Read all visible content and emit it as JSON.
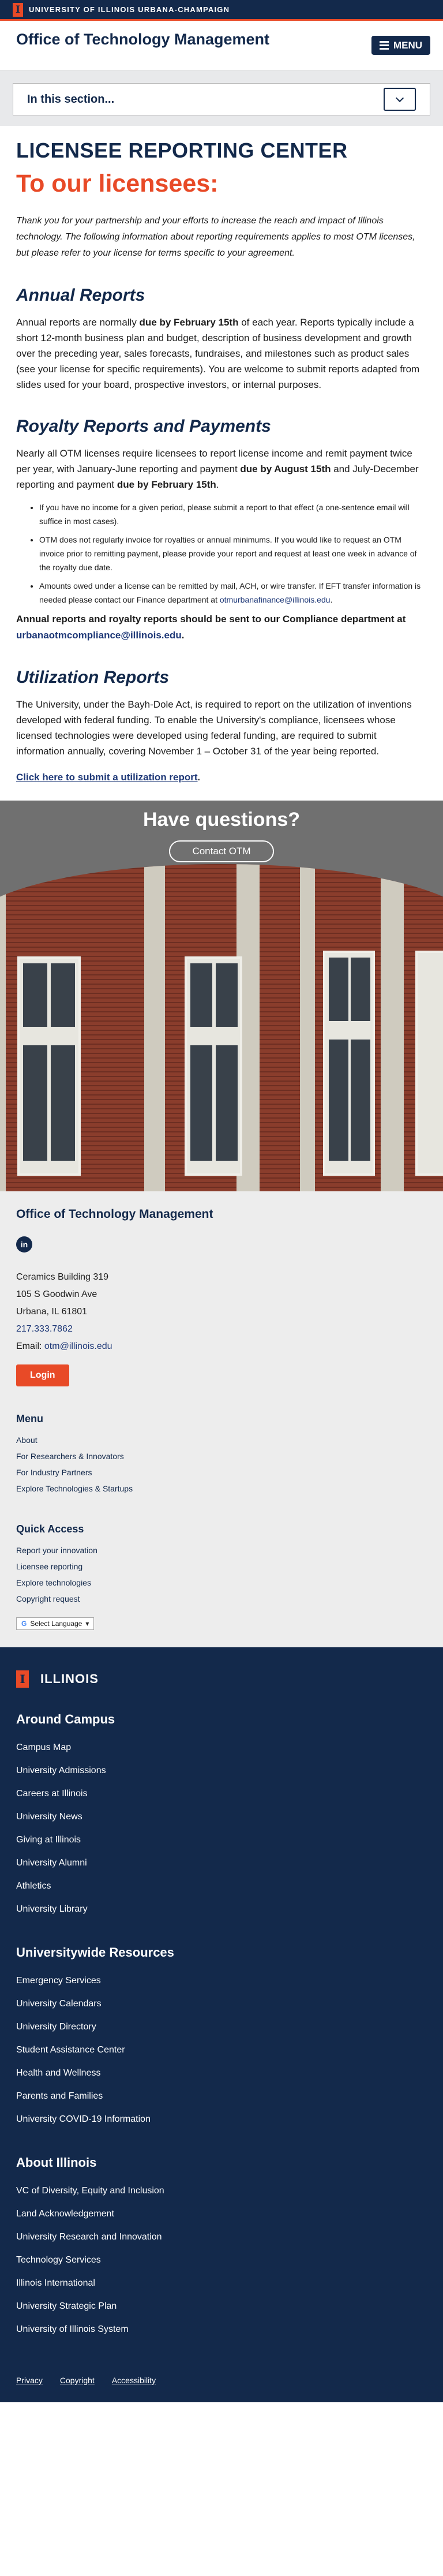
{
  "topbar": {
    "block_i": "I",
    "university": "UNIVERSITY OF ILLINOIS URBANA-CHAMPAIGN"
  },
  "header": {
    "site_title": "Office of Technology Management",
    "menu_label": "MENU"
  },
  "section_nav": {
    "label": "In this section..."
  },
  "main": {
    "page_title": "LICENSEE REPORTING CENTER",
    "subtitle": "To our licensees:",
    "intro": "Thank you for your partnership and your efforts to increase the reach and impact of Illinois technology. The following information about reporting requirements applies to most OTM licenses, but please refer to your license for terms specific to your agreement.",
    "annual": {
      "heading": "Annual Reports",
      "p1_a": "Annual reports are normally ",
      "p1_b": "due by February 15th",
      "p1_c": " of each year. Reports typically include a short 12-month business plan and budget, description of business development and growth over the preceding year, sales forecasts, fundraises, and milestones such as product sales (see your license for specific requirements). You are welcome to submit reports adapted from slides used for your board, prospective investors, or internal purposes."
    },
    "royalty": {
      "heading": "Royalty Reports and Payments",
      "p1_a": "Nearly all OTM licenses require licensees to report license income and remit payment twice per year, with January-June reporting and payment ",
      "p1_b": "due by August 15th",
      "p1_c": " and July-December reporting and payment ",
      "p1_d": "due by February 15th",
      "p1_e": ".",
      "bullets": [
        "If you have no income for a given period, please submit a report to that effect (a one-sentence email will suffice in most cases).",
        "OTM does not regularly invoice for royalties or annual minimums. If you would like to request an OTM invoice prior to remitting payment, please provide your report and request at least one week in advance of the royalty due date."
      ],
      "bullet3_a": "Amounts owed under a license can be remitted by mail, ACH, or wire transfer.  If EFT transfer information is needed please contact our Finance department at ",
      "bullet3_link": "otmurbanafinance@illinois.edu",
      "bullet3_b": ".",
      "send_a": "Annual reports and royalty reports should be sent to our Compliance department at ",
      "send_link": "urbanaotmcompliance@illinois.edu",
      "send_b": "."
    },
    "utilization": {
      "heading": "Utilization Reports",
      "p1": "The University, under the Bayh-Dole Act, is required to report on the utilization of inventions developed with federal funding. To enable the University's compliance, licensees whose licensed technologies were developed using federal funding, are required to submit information annually, covering November 1 – October 31 of the year being reported.",
      "link": "Click here to submit a utilization report",
      "link_end": "."
    }
  },
  "questions": {
    "title": "Have questions?",
    "button": "Contact OTM"
  },
  "footer_otm": {
    "title": "Office of Technology Management",
    "linkedin": "in",
    "address": [
      "Ceramics Building 319",
      "105 S Goodwin Ave",
      "Urbana, IL 61801"
    ],
    "phone": "217.333.7862",
    "email_label": "Email: ",
    "email": "otm@illinois.edu",
    "login": "Login",
    "menu_heading": "Menu",
    "menu_items": [
      "About",
      "For Researchers & Innovators",
      "For Industry Partners",
      "Explore Technologies & Startups"
    ],
    "quick_heading": "Quick Access",
    "quick_items": [
      "Report your innovation",
      "Licensee reporting",
      "Explore technologies",
      "Copyright request"
    ],
    "translate": "Select Language"
  },
  "campus": {
    "logo_text": "ILLINOIS",
    "around_heading": "Around Campus",
    "around_items": [
      "Campus Map",
      "University Admissions",
      "Careers at Illinois",
      "University News",
      "Giving at Illinois",
      "University Alumni",
      "Athletics",
      "University Library"
    ],
    "wide_heading": "Universitywide Resources",
    "wide_items": [
      "Emergency Services",
      "University Calendars",
      "University Directory",
      "Student Assistance Center",
      "Health and Wellness",
      "Parents and Families",
      "University COVID-19 Information"
    ],
    "about_heading": "About Illinois",
    "about_items": [
      "VC of Diversity, Equity and Inclusion",
      "Land Acknowledgement",
      "University Research and Innovation",
      "Technology Services",
      "Illinois International",
      "University Strategic Plan",
      "University of Illinois System"
    ],
    "bottom": [
      "Privacy",
      "Copyright",
      "Accessibility"
    ]
  }
}
